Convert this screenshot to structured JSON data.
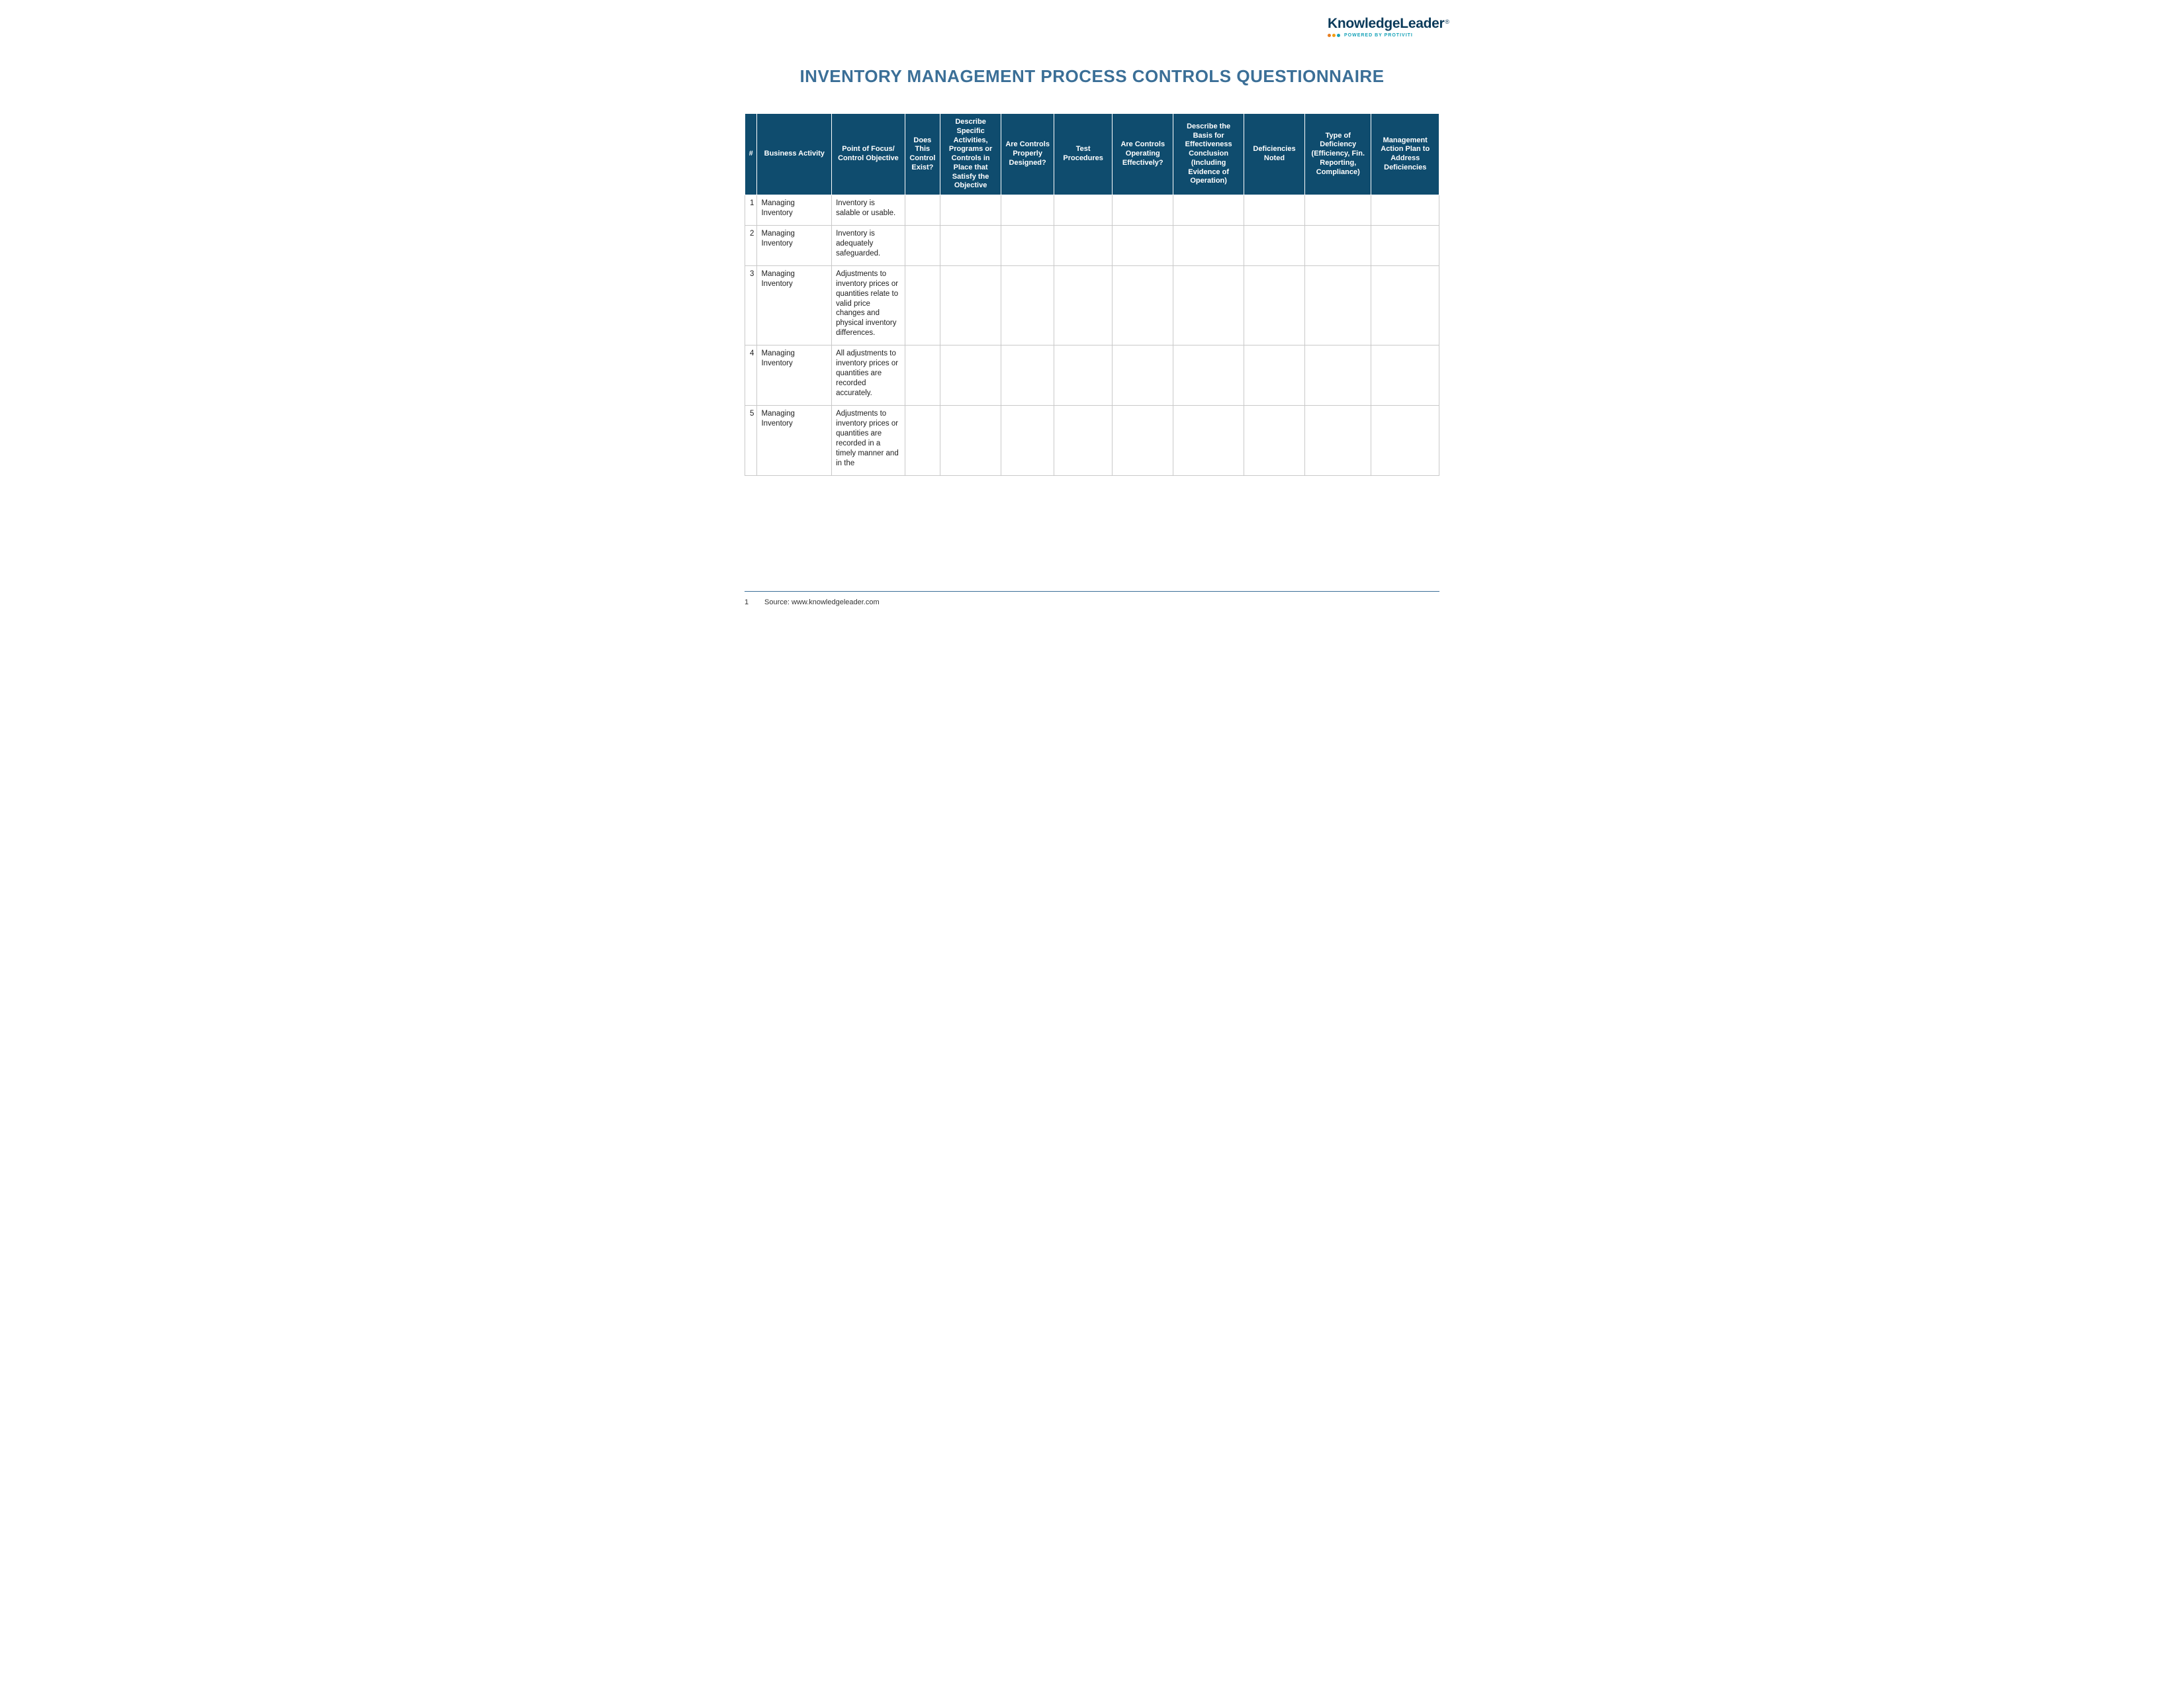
{
  "brand": {
    "name": "KnowledgeLeader",
    "tagline": "POWERED BY PROTIVITI"
  },
  "title": "INVENTORY MANAGEMENT PROCESS CONTROLS QUESTIONNAIRE",
  "columns": [
    "#",
    "Business Activity",
    "Point of Focus/ Control Objective",
    "Does This Control Exist?",
    "Describe Specific Activities, Programs or Controls in Place that Satisfy the Objective",
    "Are Controls Properly Designed?",
    "Test Procedures",
    "Are Controls Operating Effectively?",
    "Describe the Basis for Effectiveness Conclusion (Including Evidence of Operation)",
    "Deficiencies Noted",
    "Type of Deficiency (Efficiency, Fin. Reporting, Compliance)",
    "Management Action Plan to Address Deficiencies"
  ],
  "rows": [
    {
      "num": "1",
      "activity": "Managing Inventory",
      "objective": "Inventory is salable or usable."
    },
    {
      "num": "2",
      "activity": "Managing Inventory",
      "objective": "Inventory is adequately safeguarded."
    },
    {
      "num": "3",
      "activity": "Managing Inventory",
      "objective": "Adjustments to inventory prices or quantities relate to valid price changes and physical inventory differences."
    },
    {
      "num": "4",
      "activity": "Managing Inventory",
      "objective": "All adjustments to inventory prices or quantities are recorded accurately."
    },
    {
      "num": "5",
      "activity": "Managing Inventory",
      "objective": "Adjustments to inventory prices or quantities are recorded in a timely manner and in the"
    }
  ],
  "footer": {
    "page_number": "1",
    "source_text": "Source: www.knowledgeleader.com"
  }
}
